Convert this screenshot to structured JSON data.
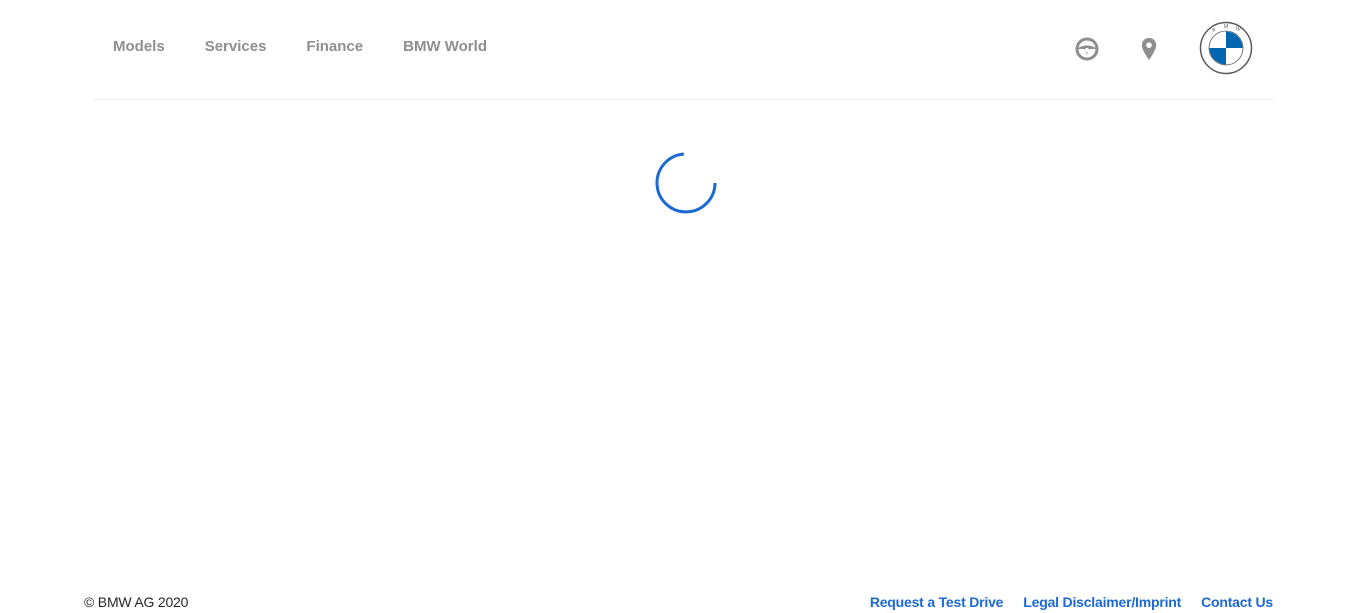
{
  "nav": {
    "items": [
      {
        "label": "Models"
      },
      {
        "label": "Services"
      },
      {
        "label": "Finance"
      },
      {
        "label": "BMW World"
      }
    ]
  },
  "header_icons": {
    "test_drive_icon": "steering-wheel-icon",
    "location_icon": "location-pin-icon",
    "logo_letters": "BMW"
  },
  "colors": {
    "nav_text": "#8e8e8e",
    "accent_blue": "#1c69d4",
    "logo_blue": "#0066b1",
    "divider": "#e6e6e6"
  },
  "main": {
    "state": "loading"
  },
  "footer": {
    "copyright": "© BMW AG 2020",
    "links": [
      {
        "label": "Request a Test Drive"
      },
      {
        "label": "Legal Disclaimer/Imprint"
      },
      {
        "label": "Contact Us"
      }
    ]
  }
}
